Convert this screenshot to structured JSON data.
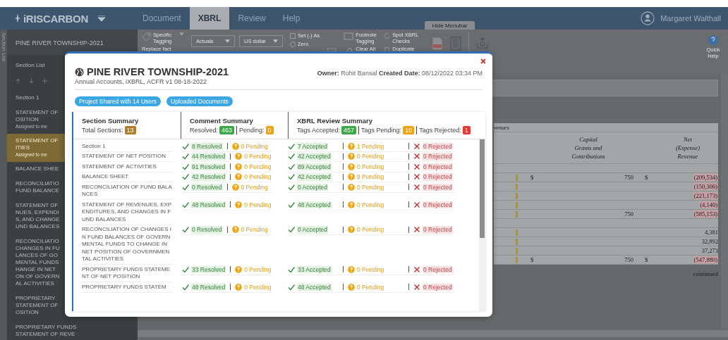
{
  "nav": {
    "logo": "iRISCARBON",
    "tabs": [
      {
        "label": "Document",
        "selected": false
      },
      {
        "label": "XBRL",
        "selected": true
      },
      {
        "label": "Review",
        "selected": false
      },
      {
        "label": "Help",
        "selected": false
      }
    ],
    "hide_menubar": "Hide Menubar",
    "user": "Margaret Walthall"
  },
  "side_tab": "Section List",
  "sidebar": {
    "project": "PINE RIVER TOWNSHIP-2021",
    "heading": "Section List",
    "items": [
      {
        "label": "Section 1",
        "selected": false
      },
      {
        "label": "STATEMENT OF\nOSITION",
        "assigned": "Assigned to me",
        "selected": false
      },
      {
        "label": "STATEMENT OF\nITIES",
        "assigned": "Assigned to me",
        "selected": true
      },
      {
        "label": "BALANCE SHEE",
        "selected": false
      },
      {
        "label": "RECONCILIATIO\nFUND BALANCE",
        "selected": false
      },
      {
        "label": "STATEMENT OF\nNUES, EXPENDI\nS, AND CHANGE\nUND BALANCES",
        "selected": false
      },
      {
        "label": "RECONCILIATIO\nCHANGES IN FU\nLANCES OF GO\nMENTAL FUNDS\nHANGE IN NET\nON OF GOVERN\nAL ACTIVITIES",
        "selected": false
      },
      {
        "label": "PROPRIETARY\nSTATEMENT OF\nOSITION",
        "selected": false
      },
      {
        "label": "PROPRIETARY FUNDS\nSTATEMENT OF REVE",
        "selected": false
      }
    ]
  },
  "ribbon": {
    "specific_tagging": "Specific Tagging",
    "replace_fact": "Replace fact",
    "dropdowns": [
      "Actuals",
      "US dollar"
    ],
    "set_as": {
      "label": "Set (-) As",
      "checked": false
    },
    "zero": "Zero",
    "footnote_tagging": "Footnote Tagging",
    "clear_all": "Clear All",
    "spot_checks": "Spot XBRL Checks",
    "duplicate": "Duplicate",
    "quick_help": "Quick Help"
  },
  "document": {
    "header_fragment": "venues",
    "columns": [
      "Capital\nGrants and\nContributions",
      "Net\n(Expense)\nRevenue"
    ],
    "rows": [
      {
        "marker": true,
        "cap_dollar": "$",
        "capital": "750",
        "net_dollar": "$",
        "net": "(209,534)",
        "highlighted": true
      },
      {
        "marker": true,
        "net": "(150,306)",
        "highlighted": true
      },
      {
        "marker": true,
        "net": "(221,173)",
        "highlighted": true
      },
      {
        "marker": true,
        "net": "(4,140)",
        "highlighted": true
      },
      {
        "marker": true,
        "capital": "750",
        "net": "(585,153)",
        "highlighted": true
      },
      {
        "marker": false
      },
      {
        "marker": true,
        "net": "4,381",
        "highlighted": false
      },
      {
        "marker": true,
        "net": "32,892",
        "highlighted": false
      },
      {
        "marker": true,
        "net": "37,273",
        "highlighted": false
      },
      {
        "marker": true,
        "cap_dollar": "$",
        "capital": "750",
        "net_dollar": "$",
        "net": "(547,880)",
        "highlighted": true
      }
    ],
    "footer": "continued"
  },
  "modal": {
    "title": "PINE RIVER TOWNSHIP-2021",
    "subtitle": "Annual Accounts, iXBRL, ACFR v1 08-18-2022",
    "meta": "**Owner:** Rohit Bansal **Created Date:** 08/12/2022 03:34 PM",
    "pills": [
      "Project Shared with 14 Users",
      "Uploaded Documents"
    ],
    "summaries": [
      {
        "title": "Section Summary",
        "counts": [
          {
            "label": "Total Sections:",
            "count": "13",
            "color": "#b07d2b"
          }
        ]
      },
      {
        "title": "Comment Summary",
        "counts": [
          {
            "label": "Resolved:",
            "count": "463",
            "color": "#3aa845"
          },
          {
            "label": "Pending:",
            "count": "0",
            "color": "#f0a30a"
          }
        ]
      },
      {
        "title": "XBRL Review Summary",
        "counts": [
          {
            "label": "Tags Accepted:",
            "count": "457",
            "color": "#3aa845"
          },
          {
            "label": "Tags Pending:",
            "count": "10",
            "color": "#f0a30a"
          },
          {
            "label": "Tags Rejected:",
            "count": "1",
            "color": "#e53935"
          }
        ]
      }
    ],
    "rows": [
      {
        "section": "Section 1",
        "comments": [
          {
            "kind": "ok",
            "text": "8 Resolved"
          },
          {
            "kind": "pending",
            "text": "0 Pending"
          }
        ],
        "tags": [
          {
            "kind": "ok",
            "text": "7 Accepted"
          },
          {
            "kind": "pending",
            "text": "1 Pending"
          },
          {
            "kind": "rejected",
            "text": "0 Rejected"
          }
        ]
      },
      {
        "section": "STATEMENT OF NET POSITION",
        "comments": [
          {
            "kind": "ok",
            "text": "44 Resolved"
          },
          {
            "kind": "pending",
            "text": "0 Pending"
          }
        ],
        "tags": [
          {
            "kind": "ok",
            "text": "42 Accepted"
          },
          {
            "kind": "pending",
            "text": "0 Pending"
          },
          {
            "kind": "rejected",
            "text": "0 Rejected"
          }
        ]
      },
      {
        "section": "STATEMENT OF ACTIVITIES",
        "comments": [
          {
            "kind": "ok",
            "text": "91 Resolved"
          },
          {
            "kind": "pending",
            "text": "0 Pending"
          }
        ],
        "tags": [
          {
            "kind": "ok",
            "text": "89 Accepted"
          },
          {
            "kind": "pending",
            "text": "0 Pending"
          },
          {
            "kind": "rejected",
            "text": "0 Rejected"
          }
        ]
      },
      {
        "section": "BALANCE SHEET",
        "comments": [
          {
            "kind": "ok",
            "text": "42 Resolved"
          },
          {
            "kind": "pending",
            "text": "0 Pending"
          }
        ],
        "tags": [
          {
            "kind": "ok",
            "text": "42 Accepted"
          },
          {
            "kind": "pending",
            "text": "9 Pending"
          },
          {
            "kind": "rejected",
            "text": "0 Rejected"
          }
        ]
      },
      {
        "section": "RECONCILIATION OF FUND BALANCES",
        "comments": [
          {
            "kind": "ok",
            "text": "0 Resolved"
          },
          {
            "kind": "pending",
            "text": "0 Pending"
          }
        ],
        "tags": [
          {
            "kind": "ok",
            "text": "0 Accepted"
          },
          {
            "kind": "pending",
            "text": "0 Pending"
          },
          {
            "kind": "rejected",
            "text": "0 Rejected"
          }
        ]
      },
      {
        "section": "STATEMENT OF REVENUES, EXPENDITURES, AND CHANGES IN FUND BALANCES",
        "comments": [
          {
            "kind": "ok",
            "text": "48 Resolved"
          },
          {
            "kind": "pending",
            "text": "0 Pending"
          }
        ],
        "tags": [
          {
            "kind": "ok",
            "text": "48 Accepted"
          },
          {
            "kind": "pending",
            "text": "0 Pending"
          },
          {
            "kind": "rejected",
            "text": "0 Rejected"
          }
        ]
      },
      {
        "section": "RECONCILIATION OF CHANGES IN FUND BALANCES OF GOVERNMENTAL FUNDS TO CHANGE IN NET POSITION OF GOVERNMENTAL ACTIVITIES",
        "comments": [
          {
            "kind": "ok",
            "text": "0 Resolved"
          },
          {
            "kind": "pending",
            "text": "0 Pending"
          }
        ],
        "tags": [
          {
            "kind": "ok",
            "text": "0 Accepted"
          },
          {
            "kind": "pending",
            "text": "0 Pending"
          },
          {
            "kind": "rejected",
            "text": "0 Rejected"
          }
        ]
      },
      {
        "section": "PROPRIETARY FUNDS STATEMENT OF NET POSITION",
        "comments": [
          {
            "kind": "ok",
            "text": "33 Resolved"
          },
          {
            "kind": "pending",
            "text": "0 Pending"
          }
        ],
        "tags": [
          {
            "kind": "ok",
            "text": "33 Accepted"
          },
          {
            "kind": "pending",
            "text": "0 Pending"
          },
          {
            "kind": "rejected",
            "text": "0 Rejected"
          }
        ]
      },
      {
        "section": "PROPRIETARY FUNDS STATEM",
        "comments": [
          {
            "kind": "ok",
            "text": "48 Resolved"
          },
          {
            "kind": "pending",
            "text": "0 Pending"
          }
        ],
        "tags": [
          {
            "kind": "ok",
            "text": "48 Accepted"
          },
          {
            "kind": "pending",
            "text": "0 Pending"
          },
          {
            "kind": "rejected",
            "text": "0 Rejected"
          }
        ]
      }
    ]
  }
}
